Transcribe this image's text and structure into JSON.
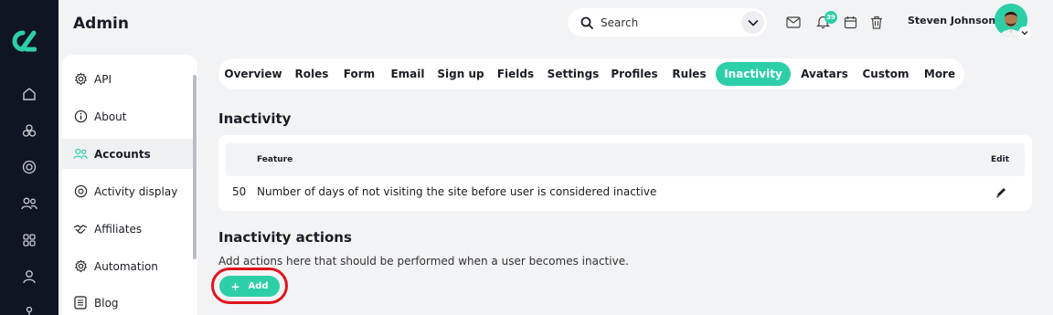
{
  "header": {
    "title": "Admin",
    "search_placeholder": "Search",
    "notification_count": "39",
    "user_name": "Steven Johnson"
  },
  "rail": {
    "icons": [
      "home-icon",
      "modules-icon",
      "target-icon",
      "people-icon",
      "grid-icon",
      "user-icon",
      "tree-icon"
    ]
  },
  "sidebar": {
    "items": [
      {
        "label": "API",
        "icon": "gear-icon"
      },
      {
        "label": "About",
        "icon": "info-icon"
      },
      {
        "label": "Accounts",
        "icon": "users-icon",
        "active": true
      },
      {
        "label": "Activity display",
        "icon": "target-icon"
      },
      {
        "label": "Affiliates",
        "icon": "handshake-icon"
      },
      {
        "label": "Automation",
        "icon": "gear-icon"
      },
      {
        "label": "Blog",
        "icon": "list-icon"
      }
    ]
  },
  "tabs": [
    {
      "label": "Overview"
    },
    {
      "label": "Roles"
    },
    {
      "label": "Form"
    },
    {
      "label": "Email"
    },
    {
      "label": "Sign up"
    },
    {
      "label": "Fields"
    },
    {
      "label": "Settings"
    },
    {
      "label": "Profiles"
    },
    {
      "label": "Rules"
    },
    {
      "label": "Inactivity",
      "active": true
    },
    {
      "label": "Avatars"
    },
    {
      "label": "Custom"
    },
    {
      "label": "More"
    }
  ],
  "inactivity": {
    "heading": "Inactivity",
    "table": {
      "columns": [
        "Feature",
        "Edit"
      ],
      "rows": [
        {
          "value": "50",
          "feature": "Number of days of not visiting the site before user is considered inactive"
        }
      ]
    }
  },
  "actions": {
    "heading": "Inactivity actions",
    "description": "Add actions here that should be performed when a user becomes inactive.",
    "add_label": "Add"
  },
  "colors": {
    "accent": "#2dcfa8",
    "rail": "#0f1523",
    "highlight": "#e0141e"
  }
}
